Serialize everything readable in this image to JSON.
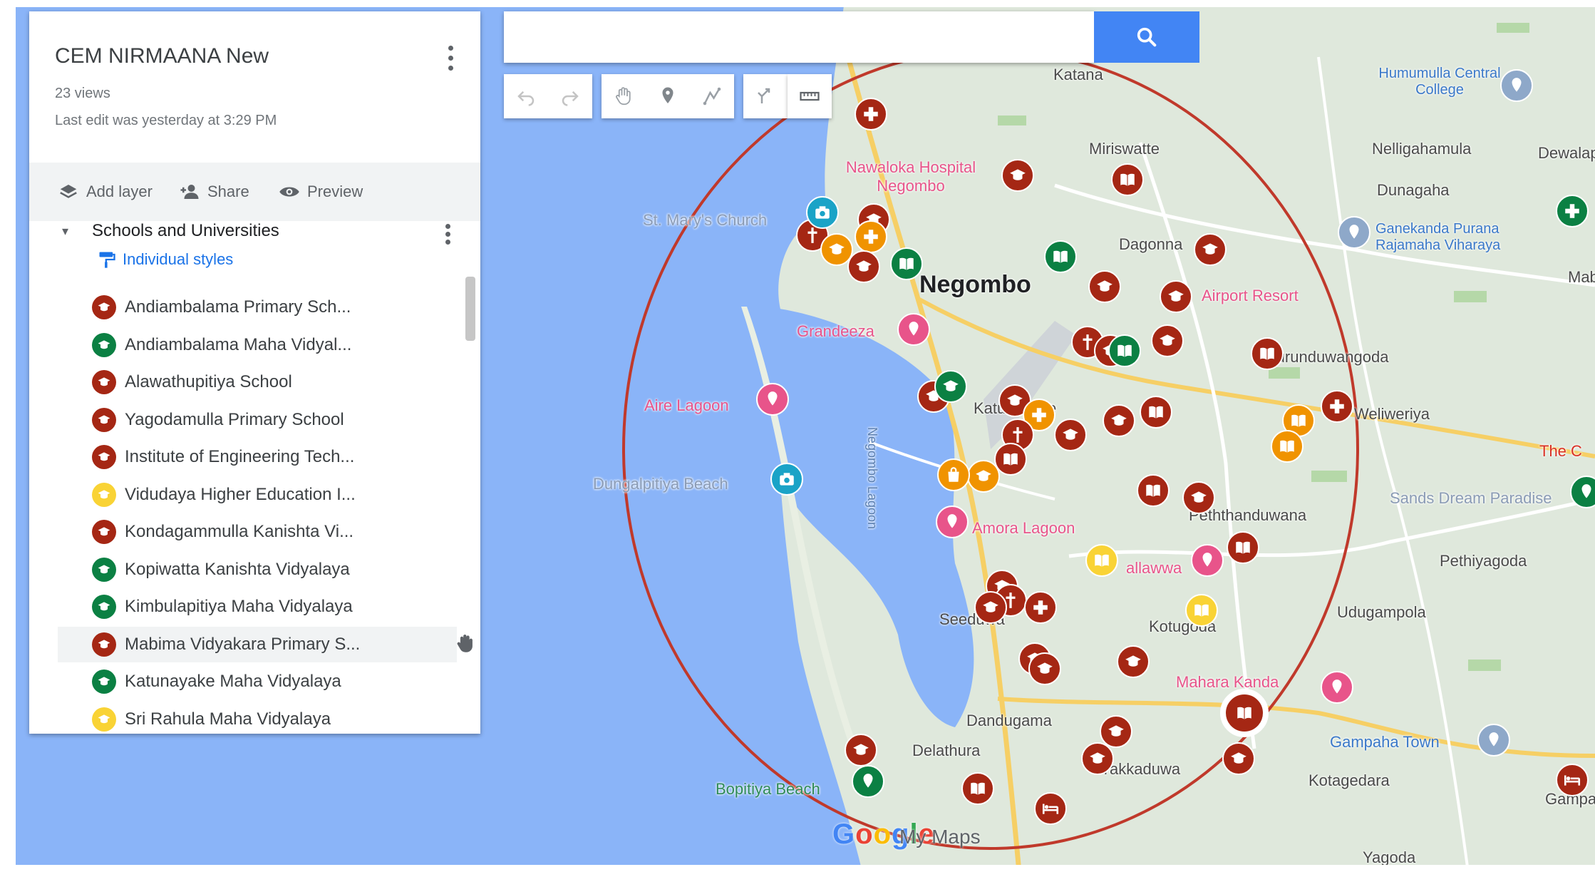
{
  "map_info": {
    "title": "CEM NIRMAANA New",
    "views": "23 views",
    "last_edit": "Last edit was yesterday at 3:29 PM"
  },
  "actions": {
    "add_layer": "Add layer",
    "share": "Share",
    "preview": "Preview"
  },
  "layer": {
    "name": "Schools and Universities",
    "style_link": "Individual styles"
  },
  "places": [
    {
      "name": "Andiambalama Primary Sch...",
      "color": "#a52714"
    },
    {
      "name": "Andiambalama Maha Vidyal...",
      "color": "#0b8043"
    },
    {
      "name": "Alawathupitiya School",
      "color": "#a52714"
    },
    {
      "name": "Yagodamulla Primary School",
      "color": "#a52714"
    },
    {
      "name": "Institute of Engineering Tech...",
      "color": "#a52714"
    },
    {
      "name": "Vidudaya Higher Education I...",
      "color": "#f9d335"
    },
    {
      "name": "Kondagammulla Kanishta Vi...",
      "color": "#a52714"
    },
    {
      "name": "Kopiwatta Kanishta Vidyalaya",
      "color": "#0b8043"
    },
    {
      "name": "Kimbulapitiya Maha Vidyalaya",
      "color": "#0b8043"
    },
    {
      "name": "Mabima Vidyakara Primary S...",
      "color": "#a52714"
    },
    {
      "name": "Katunayake Maha Vidyalaya",
      "color": "#0b8043"
    },
    {
      "name": "Sri Rahula Maha Vidyalaya",
      "color": "#f9d335"
    }
  ],
  "search": {
    "value": ""
  },
  "map_labels": {
    "katana": "Katana",
    "humumulla": "Humumulla Central College",
    "miriswatte": "Miriswatte",
    "nelligahamula": "Nelligahamula",
    "dunagaha": "Dunagaha",
    "dewalapola": "Dewalap",
    "nawaloka": "Nawaloka Hospital Negombo",
    "st_marys": "St. Mary's Church",
    "dagonna": "Dagonna",
    "ganekanda": "Ganekanda Purana Rajamaha Viharaya",
    "mabo": "Mabo",
    "negombo": "Negombo",
    "airport_resort": "Airport Resort",
    "grandeeza": "Grandeeza",
    "kurunduwangoda": "Kurunduwangoda",
    "aire_lagoon": "Aire Lagoon",
    "katunayake": "Katunayake",
    "weliweriya": "Weliweriya",
    "the_c": "The C",
    "lagoon": "Negombo Lagoon",
    "dungalpitiya": "Dungalpitiya Beach",
    "sands": "Sands Dream Paradise",
    "pethandwana": "Peththanduwana",
    "amora": "Amora Lagoon",
    "pethiyagoda": "Pethiyagoda",
    "allawwa": "allawwa",
    "seeduwa": "Seeduwa",
    "kotugoda": "Kotugoda",
    "udugampola": "Udugampola",
    "mahara": "Mahara Kanda",
    "dandugama": "Dandugama",
    "delathura": "Delathura",
    "gampaha": "Gampaha Town",
    "yakkaduwa": "Yakkaduwa",
    "kotagedara": "Kotagedara",
    "bopitiya": "Bopitiya Beach",
    "gampaha2": "Gampa",
    "yagoda": "Yagoda",
    "my_maps": "My Maps"
  },
  "colors": {
    "red_pin": "#a52714",
    "green_pin": "#0b8043",
    "yellow_pin": "#f9d335",
    "orange_pin": "#f09300",
    "pink_pin": "#e8548a",
    "circle": "#c0392b",
    "water": "#8ab4f8",
    "land": "#dfe8dc"
  }
}
